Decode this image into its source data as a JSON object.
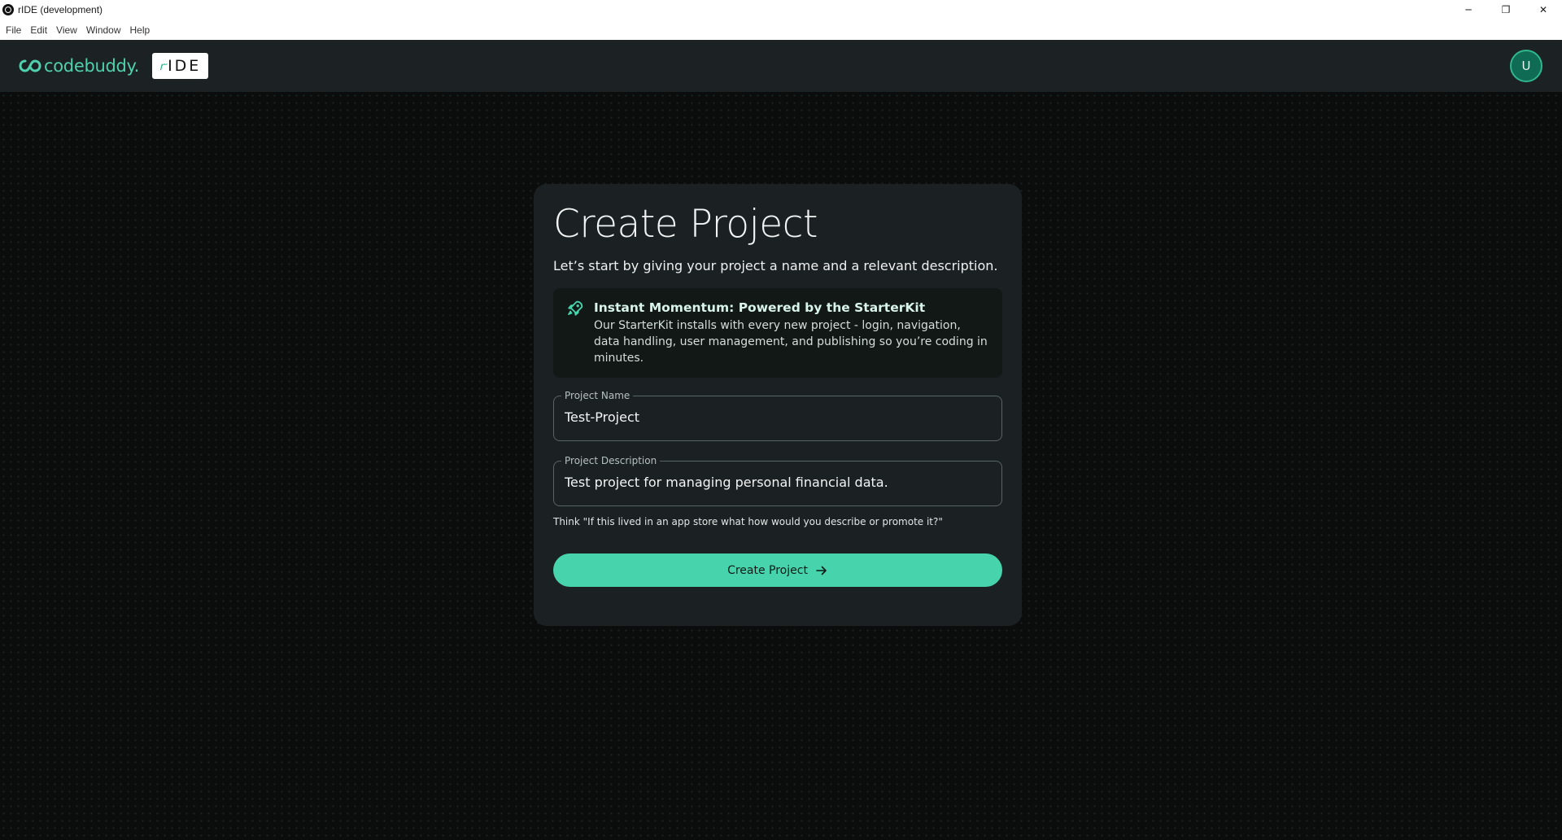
{
  "window": {
    "title": "rIDE (development)",
    "minimize": "─",
    "maximize": "❐",
    "close": "✕"
  },
  "menu": [
    "File",
    "Edit",
    "View",
    "Window",
    "Help"
  ],
  "header": {
    "brand_name": "codebuddy.",
    "badge_text": "IDE",
    "avatar_initial": "U"
  },
  "card": {
    "title": "Create Project",
    "subtitle": "Let’s start by giving your project a name and a relevant description.",
    "info": {
      "icon": "rocket-icon",
      "title": "Instant Momentum: Powered by the StarterKit",
      "body": "Our StarterKit installs with every new project - login, navigation, data handling, user management, and publishing so you’re coding in minutes."
    },
    "project_name": {
      "label": "Project Name",
      "value": "Test-Project"
    },
    "project_description": {
      "label": "Project Description",
      "value": "Test project for managing personal financial data."
    },
    "hint": "Think \"If this lived in an app store what how would you describe or promote it?\"",
    "create_button": "Create Project"
  },
  "colors": {
    "accent": "#47d4ad",
    "brand": "#4fd1ad",
    "header_bg": "#1c2124",
    "card_bg": "#1b2023",
    "canvas_bg": "#0b0d0d"
  }
}
